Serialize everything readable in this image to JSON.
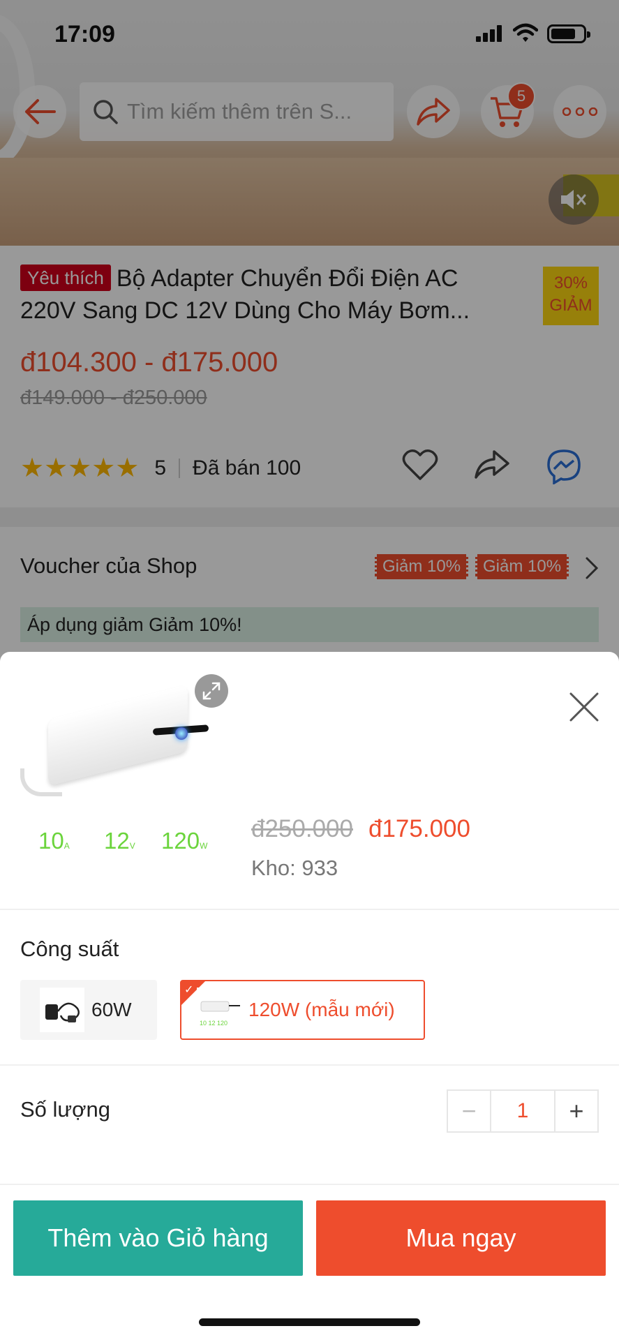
{
  "status_bar": {
    "time": "17:09"
  },
  "search": {
    "placeholder": "Tìm kiếm thêm trên S..."
  },
  "cart": {
    "badge_count": "5"
  },
  "product": {
    "favorite_tag": "Yêu thích",
    "title": "Bộ Adapter Chuyển Đổi Điện AC 220V Sang DC 12V Dùng Cho Máy Bơm...",
    "discount_percent": "30%",
    "discount_word": "GIẢM",
    "price_range": "đ104.300 - đ175.000",
    "original_price_range": "đ149.000 - đ250.000",
    "rating_stars": 5,
    "rating_value": "5",
    "sold": "Đã bán 100"
  },
  "voucher": {
    "title": "Voucher của Shop",
    "tags": [
      "Giảm 10%",
      "Giảm 10%"
    ],
    "apply_text": "Áp dụng giảm Giảm 10%!"
  },
  "sheet": {
    "image_specs": [
      "10",
      "12",
      "120"
    ],
    "image_spec_units": [
      "A",
      "V",
      "W"
    ],
    "old_price": "đ250.000",
    "new_price": "đ175.000",
    "stock": "Kho: 933",
    "option_label": "Công suất",
    "options": [
      {
        "label": "60W",
        "selected": false
      },
      {
        "label": "120W (mẫu mới)",
        "selected": true
      }
    ],
    "quantity_label": "Số lượng",
    "quantity": "1",
    "minus": "−",
    "plus": "+",
    "add_to_cart": "Thêm vào Giỏ hàng",
    "buy_now": "Mua ngay"
  },
  "colors": {
    "brand": "#ee4d2d",
    "cart_button": "#26aa99",
    "star": "#ffb800",
    "voucher_apply_bg": "#dbf1e4"
  },
  "icons": [
    "back-arrow-icon",
    "search-icon",
    "share-icon",
    "cart-icon",
    "more-icon",
    "mute-icon",
    "heart-icon",
    "messenger-icon",
    "chevron-right-icon",
    "expand-icon",
    "close-icon"
  ]
}
